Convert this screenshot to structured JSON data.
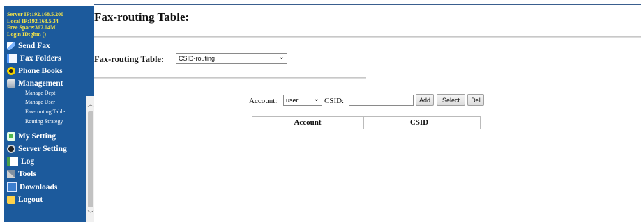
{
  "sidebar": {
    "server_info": {
      "server_ip": "Server IP:192.168.5.200",
      "local_ip": "Local IP:192.168.5.34",
      "free_space": "Free Space:367.04M",
      "login_id": "Login ID:ghm ()"
    },
    "nav": [
      {
        "label": "Send Fax",
        "icon": "send-fax-icon"
      },
      {
        "label": "Fax Folders",
        "icon": "folder-icon"
      },
      {
        "label": "Phone Books",
        "icon": "phone-book-icon"
      },
      {
        "label": "Management",
        "icon": "management-icon"
      },
      {
        "label": "My Setting",
        "icon": "settings-icon"
      },
      {
        "label": "Server Setting",
        "icon": "server-icon"
      },
      {
        "label": "Log",
        "icon": "log-icon"
      },
      {
        "label": "Tools",
        "icon": "tools-icon"
      },
      {
        "label": "Downloads",
        "icon": "download-icon"
      },
      {
        "label": "Logout",
        "icon": "logout-icon"
      }
    ],
    "management_sub": [
      {
        "label": "Manage Dept"
      },
      {
        "label": "Manage User"
      },
      {
        "label": "Fax-routing Table"
      },
      {
        "label": "Routing Strategy"
      }
    ],
    "colors": {
      "background": "#1c5a9c",
      "info_text": "#f2e24a",
      "nav_text": "#ffffff"
    }
  },
  "main": {
    "title": "Fax-routing Table:",
    "routing_label": "Fax-routing Table:",
    "routing_select_value": "CSID-routing",
    "account_label": "Account:",
    "account_select_value": "user",
    "csid_label": "CSID:",
    "csid_value": "",
    "buttons": {
      "add": "Add",
      "select": "Select",
      "del": "Del"
    },
    "table": {
      "columns": [
        "Account",
        "CSID"
      ],
      "rows": []
    }
  }
}
